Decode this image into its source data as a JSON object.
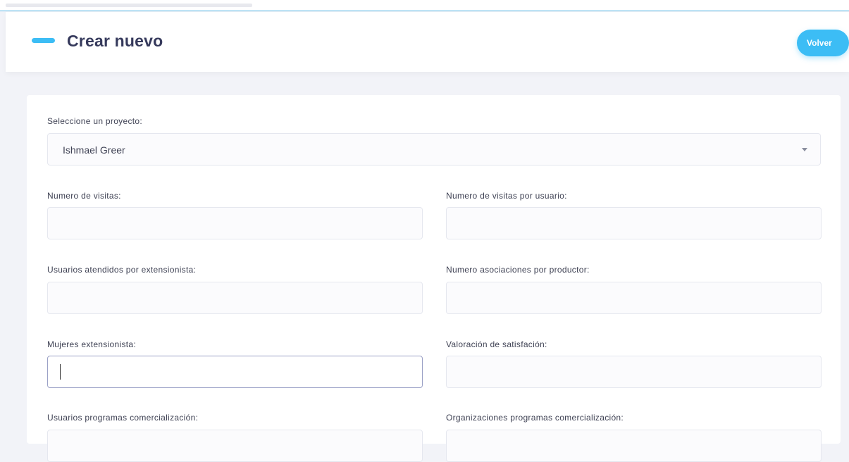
{
  "header": {
    "title": "Crear nuevo",
    "back_label": "Volver"
  },
  "form": {
    "project_label": "Seleccione un proyecto:",
    "project_value": "Ishmael Greer",
    "fields": [
      {
        "label": "Numero de visitas:",
        "value": ""
      },
      {
        "label": "Numero de visitas por usuario:",
        "value": ""
      },
      {
        "label": "Usuarios atendidos por extensionista:",
        "value": ""
      },
      {
        "label": "Numero asociaciones por productor:",
        "value": ""
      },
      {
        "label": "Mujeres extensionista:",
        "value": ""
      },
      {
        "label": "Valoración de satisfación:",
        "value": ""
      },
      {
        "label": "Usuarios programas comercialización:",
        "value": ""
      },
      {
        "label": "Organizaciones programas comercialización:",
        "value": ""
      }
    ]
  },
  "colors": {
    "accent": "#3cbdf5",
    "title": "#363a5c",
    "background": "#f2f3f8"
  },
  "icons": {
    "accent": "title-accent-bar",
    "select": "chevron-down-icon"
  }
}
